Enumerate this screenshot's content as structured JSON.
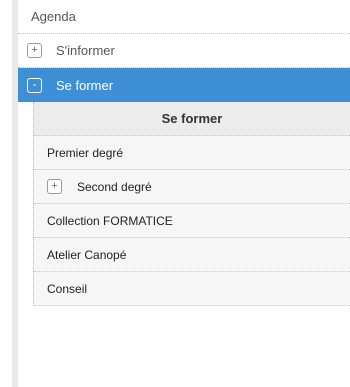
{
  "menu": {
    "items": [
      {
        "label": "Agenda"
      },
      {
        "label": "S'informer",
        "toggle": "+"
      },
      {
        "label": "Se former",
        "toggle": "-"
      }
    ]
  },
  "submenu": {
    "title": "Se former",
    "items": [
      {
        "label": "Premier degré"
      },
      {
        "label": "Second degré",
        "toggle": "+"
      },
      {
        "label": "Collection FORMATICE"
      },
      {
        "label": "Atelier Canopé"
      },
      {
        "label": "Conseil"
      }
    ]
  },
  "colors": {
    "active_bg": "#3f8fd6",
    "subheader_bg": "#ececec",
    "submenu_bg": "#f6f6f6"
  }
}
